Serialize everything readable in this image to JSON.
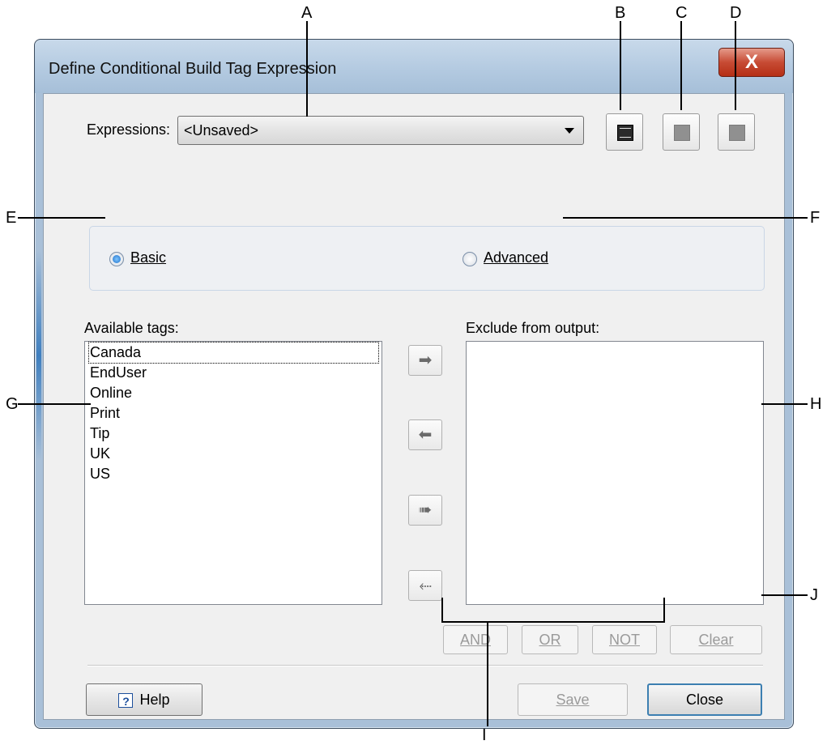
{
  "callouts": [
    "A",
    "B",
    "C",
    "D",
    "E",
    "F",
    "G",
    "H",
    "I",
    "J"
  ],
  "window": {
    "title": "Define Conditional Build Tag Expression",
    "close_glyph": "X"
  },
  "expressions": {
    "label": "Expressions:",
    "value": "<Unsaved>"
  },
  "toolbar": {
    "icons": [
      "save-as-icon",
      "rename-icon",
      "delete-icon"
    ]
  },
  "mode": {
    "basic_label": "Basic",
    "advanced_label": "Advanced",
    "selected": "Basic"
  },
  "available": {
    "label": "Available tags:",
    "items": [
      "Canada",
      "EndUser",
      "Online",
      "Print",
      "Tip",
      "UK",
      "US"
    ]
  },
  "exclude": {
    "label": "Exclude from output:",
    "items": []
  },
  "move_buttons": [
    "➡",
    "⬅",
    "➠",
    "⬸"
  ],
  "operators": {
    "and": "AND",
    "or": "OR",
    "not": "NOT",
    "clear": "Clear"
  },
  "footer": {
    "help": "Help",
    "save": "Save",
    "close": "Close"
  }
}
